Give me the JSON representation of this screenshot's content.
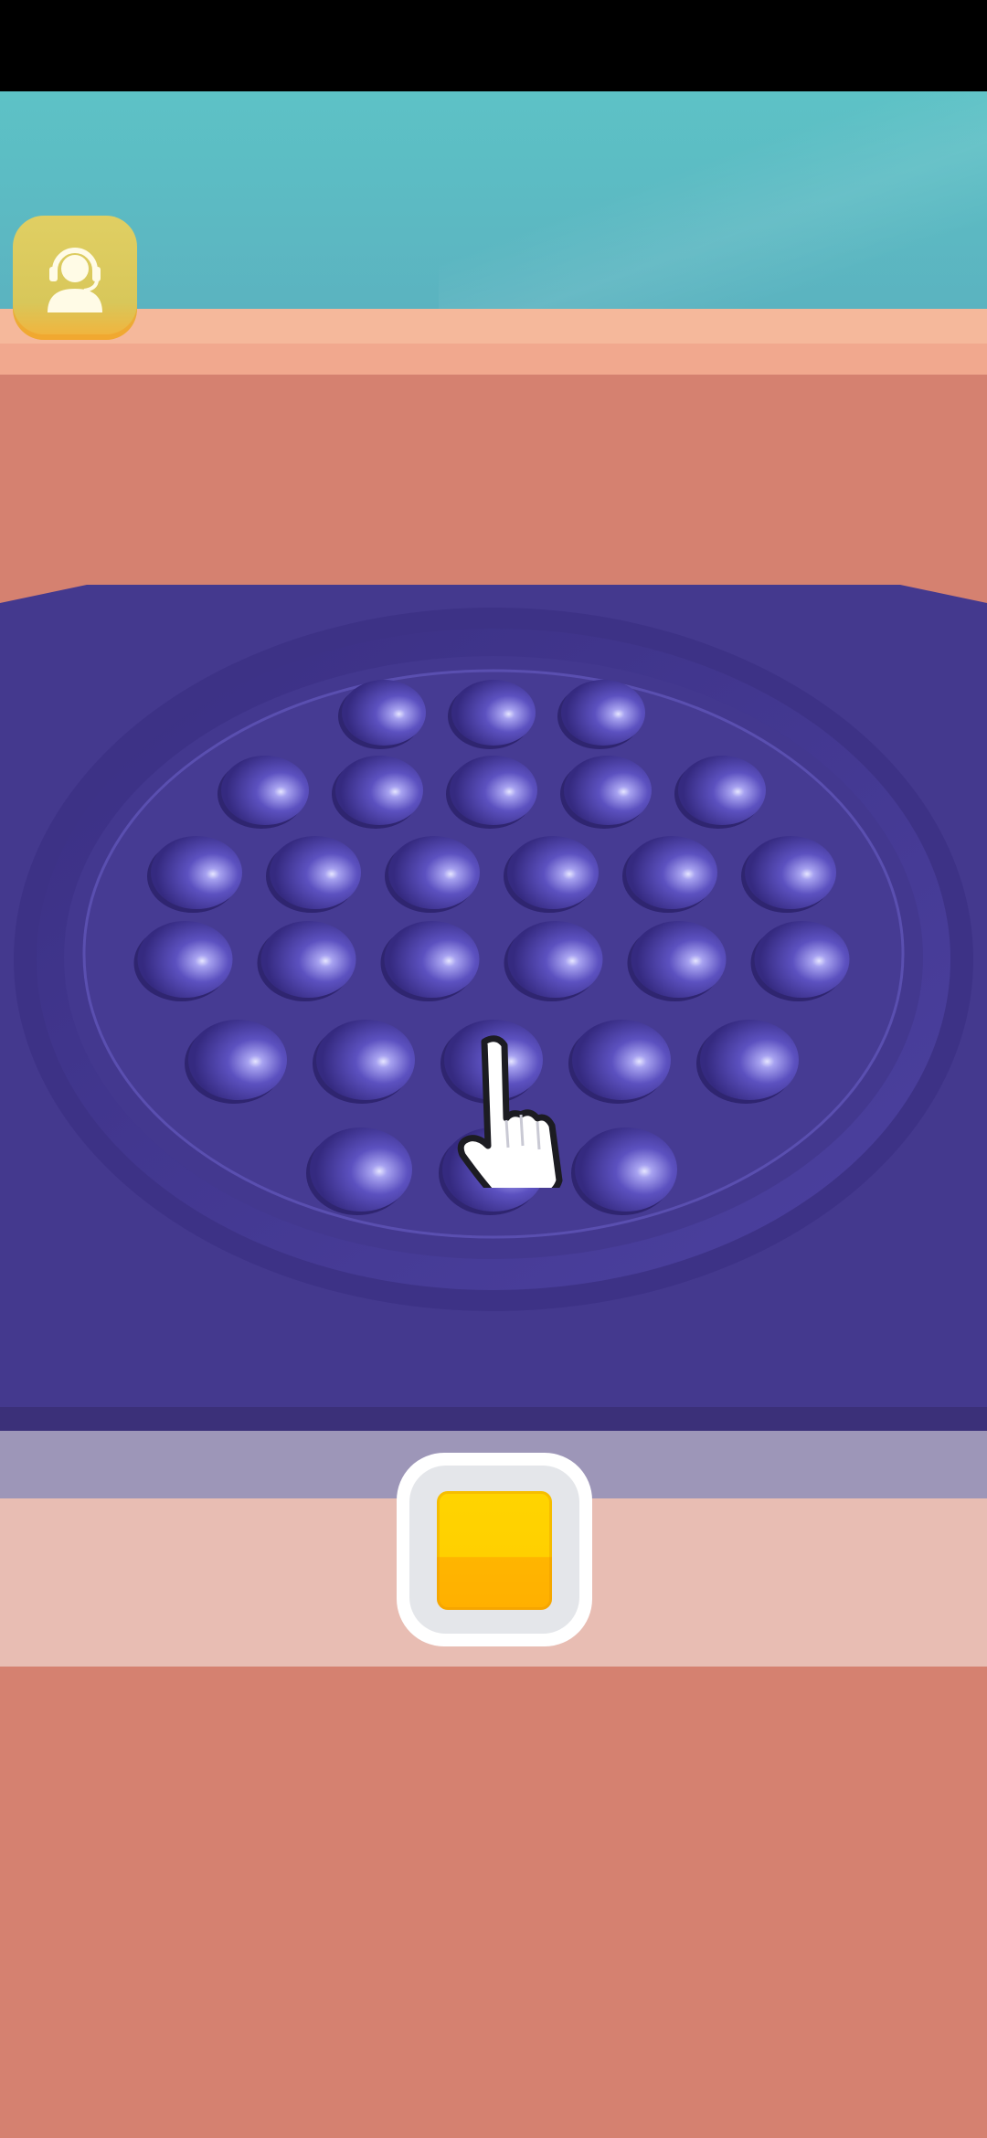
{
  "game": {
    "board_color": "#44398e",
    "bubble_rows": [
      3,
      5,
      6,
      6,
      5,
      3
    ],
    "selected_color": "#ffd000"
  },
  "icons": {
    "support": "support-agent-icon",
    "pointer": "hand-pointer-icon"
  }
}
